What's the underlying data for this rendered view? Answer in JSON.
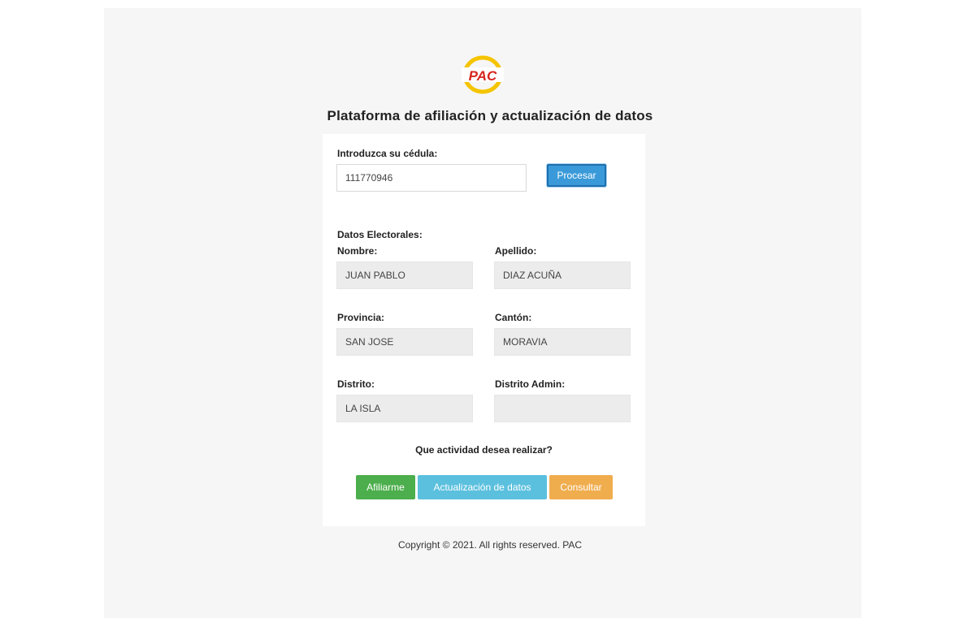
{
  "brand": {
    "logo_text": "PAC",
    "ring_color": "#f5c400",
    "text_color": "#d7261e"
  },
  "page_title": "Plataforma de afiliación y actualización de datos",
  "form": {
    "cedula_label": "Introduzca su cédula:",
    "cedula_value": "111770946",
    "process_button": "Procesar"
  },
  "electoral": {
    "section_label": "Datos Electorales:",
    "fields": {
      "nombre": {
        "label": "Nombre:",
        "value": "JUAN PABLO"
      },
      "apellido": {
        "label": "Apellido:",
        "value": "DIAZ ACUÑA"
      },
      "provincia": {
        "label": "Provincia:",
        "value": "SAN JOSE"
      },
      "canton": {
        "label": "Cantón:",
        "value": "MORAVIA"
      },
      "distrito": {
        "label": "Distrito:",
        "value": "LA ISLA"
      },
      "distrito_admin": {
        "label": "Distrito Admin:",
        "value": ""
      }
    }
  },
  "actions": {
    "question": "Que actividad desea realizar?",
    "affiliate": "Afiliarme",
    "update": "Actualización de datos",
    "consult": "Consultar",
    "colors": {
      "affiliate": "#4cae4c",
      "update": "#5bc0de",
      "consult": "#f0ad4e",
      "process": "#3a9ad9"
    }
  },
  "footer": "Copyright © 2021. All rights reserved. PAC"
}
